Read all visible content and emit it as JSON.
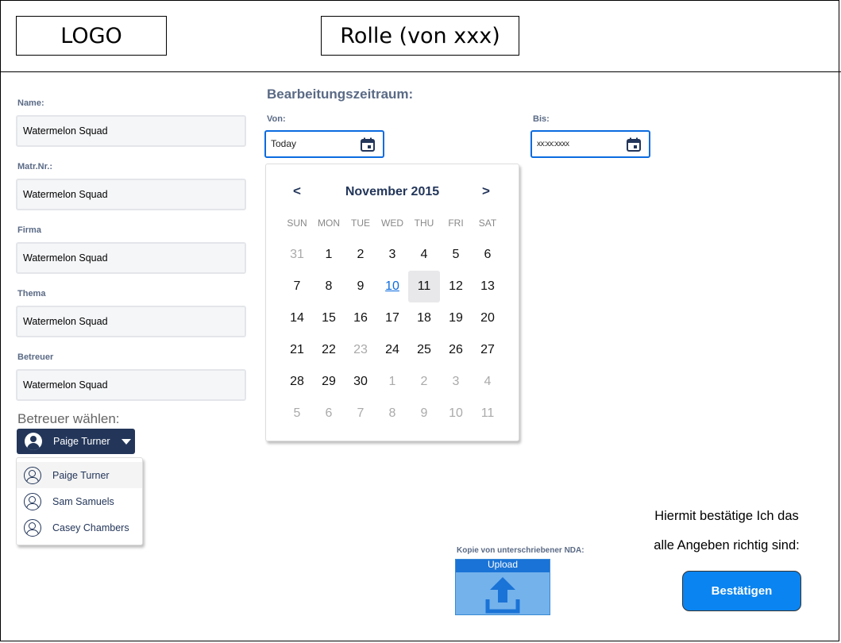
{
  "header": {
    "logo": "LOGO",
    "role": "Rolle (von xxx)"
  },
  "form": {
    "fields": [
      {
        "label": "Name:",
        "value": "Watermelon Squad"
      },
      {
        "label": "Matr.Nr.:",
        "value": "Watermelon Squad"
      },
      {
        "label": "Firma",
        "value": "Watermelon Squad"
      },
      {
        "label": "Thema",
        "value": "Watermelon Squad"
      },
      {
        "label": "Betreuer",
        "value": "Watermelon Squad"
      }
    ]
  },
  "supervisor": {
    "heading": "Betreuer wählen:",
    "selected": "Paige Turner",
    "options": [
      "Paige Turner",
      "Sam Samuels",
      "Casey Chambers"
    ]
  },
  "period": {
    "heading": "Bearbeitungszeitraum:",
    "from_label": "Von:",
    "from_value": "Today",
    "to_label": "Bis:",
    "to_value": "xx:xx:xxxx"
  },
  "calendar": {
    "prev": "<",
    "next": ">",
    "month": "November 2015",
    "weekdays": [
      "SUN",
      "MON",
      "TUE",
      "WED",
      "THU",
      "FRI",
      "SAT"
    ],
    "weeks": [
      [
        "31",
        "1",
        "2",
        "3",
        "4",
        "5",
        "6"
      ],
      [
        "7",
        "8",
        "9",
        "10",
        "11",
        "12",
        "13"
      ],
      [
        "14",
        "15",
        "16",
        "17",
        "18",
        "19",
        "20"
      ],
      [
        "21",
        "22",
        "23",
        "24",
        "25",
        "26",
        "27"
      ],
      [
        "28",
        "29",
        "30",
        "1",
        "2",
        "3",
        "4"
      ],
      [
        "5",
        "6",
        "7",
        "8",
        "9",
        "10",
        "11"
      ]
    ],
    "today": "10",
    "selected": "11",
    "disabled_in_month": [
      "23"
    ]
  },
  "nda": {
    "label": "Kopie von unterschriebener NDA:",
    "upload_label": "Upload"
  },
  "confirm": {
    "line1": "Hiermit bestätige Ich das",
    "line2": "alle Angeben richtig sind:",
    "button": "Bestätigen"
  },
  "colors": {
    "accent": "#0b6be0",
    "navy": "#23365a",
    "button": "#0a84f0",
    "label": "#5a6a85"
  }
}
